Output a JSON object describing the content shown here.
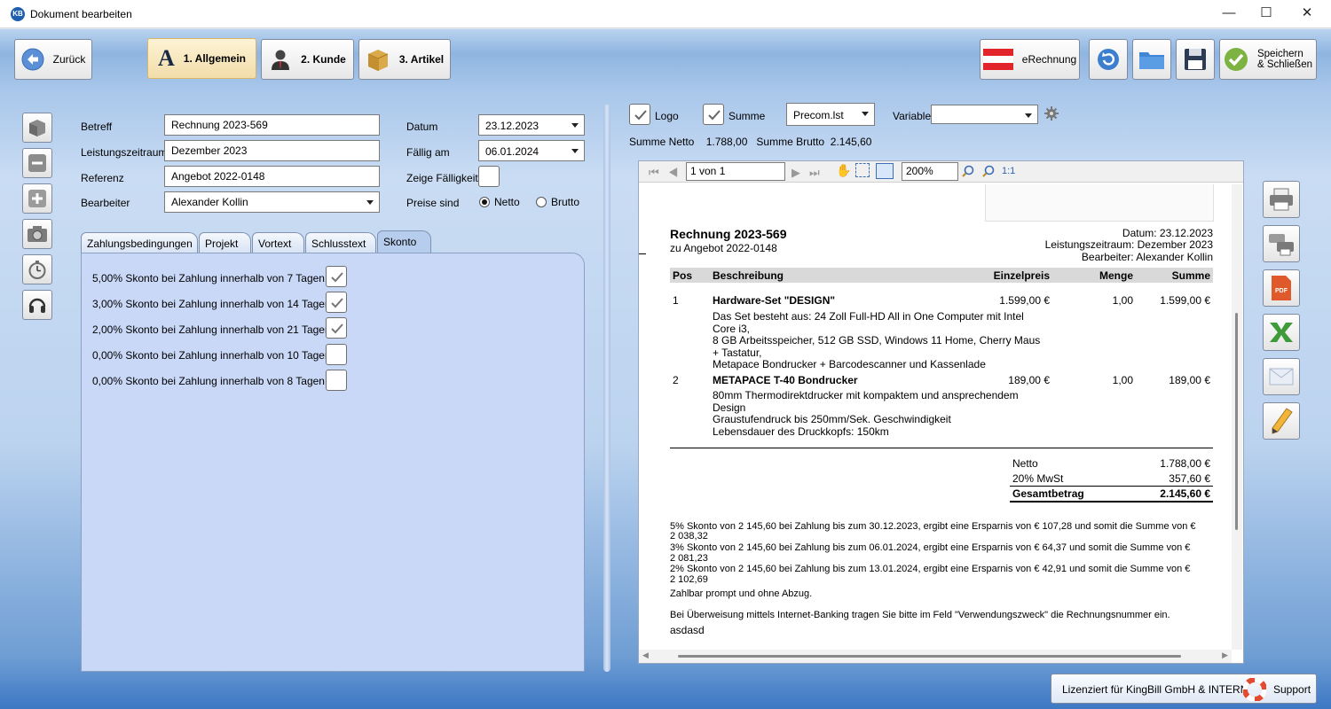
{
  "window": {
    "title": "Dokument bearbeiten",
    "app_icon": "KB",
    "minimize": "—",
    "maximize": "☐",
    "close": "✕"
  },
  "toolbar": {
    "back": "Zurück",
    "tab1_letter": "A",
    "tab1": "1. Allgemein",
    "tab2": "2. Kunde",
    "tab3": "3. Artikel",
    "erechnung": "eRechnung",
    "save_close": "Speichern\n& Schließen"
  },
  "form": {
    "betreff_label": "Betreff",
    "betreff": "Rechnung 2023-569",
    "leistung_label": "Leistungszeitraum",
    "leistung": "Dezember 2023",
    "referenz_label": "Referenz",
    "referenz": "Angebot 2022-0148",
    "bearbeiter_label": "Bearbeiter",
    "bearbeiter": "Alexander Kollin",
    "datum_label": "Datum",
    "datum": "23.12.2023",
    "faellig_label": "Fällig am",
    "faellig": "06.01.2024",
    "zeige_label": "Zeige Fälligkeit",
    "preise_label": "Preise sind",
    "netto": "Netto",
    "brutto": "Brutto"
  },
  "tabs": [
    "Zahlungsbedingungen",
    "Projekt",
    "Vortext",
    "Schlusstext",
    "Skonto"
  ],
  "skonto": [
    {
      "text": "5,00% Skonto bei Zahlung innerhalb von 7 Tagen",
      "checked": true
    },
    {
      "text": "3,00% Skonto bei Zahlung innerhalb von 14 Tagen",
      "checked": true
    },
    {
      "text": "2,00% Skonto bei Zahlung innerhalb von 21 Tagen",
      "checked": true
    },
    {
      "text": "0,00% Skonto bei Zahlung innerhalb von 10 Tagen",
      "checked": false
    },
    {
      "text": "0,00% Skonto bei Zahlung innerhalb von 8 Tagen",
      "checked": false
    }
  ],
  "options": {
    "logo": "Logo",
    "summe": "Summe",
    "layout": "Precom.lst",
    "variable_label": "Variable",
    "variable": "",
    "summary": "Summe Netto    1.788,00   Summe Brutto  2.145,60"
  },
  "viewer": {
    "page": "1 von 1",
    "zoom": "200%",
    "onetoone": "1:1"
  },
  "doc": {
    "title": "Rechnung 2023-569",
    "subtitle": "zu Angebot 2022-0148",
    "datum": "Datum: 23.12.2023",
    "leistung": "Leistungszeitraum: Dezember 2023",
    "bearbeiter": "Bearbeiter: Alexander Kollin",
    "headers": {
      "pos": "Pos",
      "desc": "Beschreibung",
      "price": "Einzelpreis",
      "qty": "Menge",
      "sum": "Summe"
    },
    "items": [
      {
        "pos": "1",
        "name": "Hardware-Set \"DESIGN\"",
        "price": "1.599,00 €",
        "qty": "1,00",
        "sum": "1.599,00 €",
        "desc": [
          "Das Set besteht aus: 24 Zoll Full-HD All in One Computer mit Intel",
          "Core i3,",
          "8 GB Arbeitsspeicher, 512 GB SSD, Windows 11 Home, Cherry Maus",
          "+ Tastatur,",
          "Metapace Bondrucker + Barcodescanner und Kassenlade"
        ]
      },
      {
        "pos": "2",
        "name": "METAPACE T-40 Bondrucker",
        "price": "189,00 €",
        "qty": "1,00",
        "sum": "189,00 €",
        "desc": [
          "80mm Thermodirektdrucker mit kompaktem und ansprechendem",
          "Design",
          "Graustufendruck bis 250mm/Sek. Geschwindigkeit",
          "Lebensdauer des Druckkopfs: 150km"
        ]
      }
    ],
    "netto_label": "Netto",
    "netto": "1.788,00 €",
    "mwst_label": "20% MwSt",
    "mwst": "357,60 €",
    "gesamt_label": "Gesamtbetrag",
    "gesamt": "2.145,60 €",
    "skonto_lines": [
      "5% Skonto von 2 145,60 bei Zahlung bis zum 30.12.2023, ergibt eine Ersparnis von € 107,28 und somit die Summe von €",
      "2 038,32",
      "3% Skonto von 2 145,60 bei Zahlung bis zum 06.01.2024, ergibt eine Ersparnis von € 64,37 und somit die Summe von €",
      "2 081,23",
      "2% Skonto von 2 145,60 bei Zahlung bis zum 13.01.2024, ergibt eine Ersparnis von € 42,91 und somit die Summe von €",
      "2 102,69"
    ],
    "zahlbar": "Zahlbar prompt und ohne Abzug.",
    "ueberweisung": "Bei Überweisung mittels Internet-Banking tragen Sie bitte im Feld \"Verwendungszweck\" die Rechnungsnummer ein.",
    "extra": "asdasd"
  },
  "footer": {
    "license": "Lizenziert für KingBill GmbH & INTERN",
    "support": "Support"
  }
}
